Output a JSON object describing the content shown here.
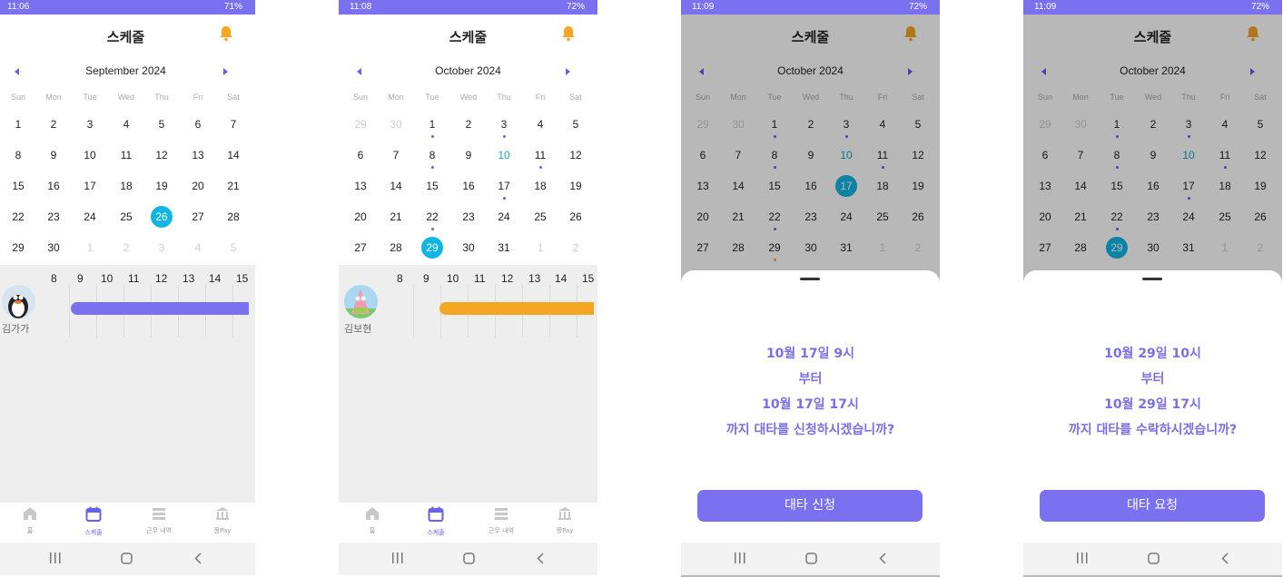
{
  "colors": {
    "accent": "#7b70f0",
    "selected": "#11b5e4",
    "today": "#1da1c8",
    "bell": "#f5a623",
    "bar_purple": "#7b70f0",
    "bar_orange": "#f5a623"
  },
  "weekdays": [
    "Sun",
    "Mon",
    "Tue",
    "Wed",
    "Thu",
    "Fri",
    "Sat"
  ],
  "screens": [
    {
      "status": {
        "time": "11:06",
        "right": "71%"
      },
      "header": {
        "title": "스케줄"
      },
      "month": "September 2024",
      "days": [
        [
          "1",
          "2",
          "3",
          "4",
          "5",
          "6",
          "7"
        ],
        [
          "8",
          "9",
          "10",
          "11",
          "12",
          "13",
          "14"
        ],
        [
          "15",
          "16",
          "17",
          "18",
          "19",
          "20",
          "21"
        ],
        [
          "22",
          "23",
          "24",
          "25",
          "26",
          "27",
          "28"
        ],
        [
          "29",
          "30",
          "1",
          "2",
          "3",
          "4",
          "5"
        ]
      ],
      "hours": [
        "8",
        "9",
        "10",
        "11",
        "12",
        "13",
        "14",
        "15"
      ],
      "user": {
        "name": "김가가"
      },
      "nav": [
        "홈",
        "스케줄",
        "근무 내역",
        "짱Pay"
      ]
    },
    {
      "status": {
        "time": "11:08",
        "right": "72%"
      },
      "header": {
        "title": "스케줄"
      },
      "month": "October 2024",
      "days": [
        [
          "29",
          "30",
          "1",
          "2",
          "3",
          "4",
          "5"
        ],
        [
          "6",
          "7",
          "8",
          "9",
          "10",
          "11",
          "12"
        ],
        [
          "13",
          "14",
          "15",
          "16",
          "17",
          "18",
          "19"
        ],
        [
          "20",
          "21",
          "22",
          "23",
          "24",
          "25",
          "26"
        ],
        [
          "27",
          "28",
          "29",
          "30",
          "31",
          "1",
          "2"
        ]
      ],
      "hours": [
        "8",
        "9",
        "10",
        "11",
        "12",
        "13",
        "14",
        "15"
      ],
      "user": {
        "name": "김보현"
      },
      "nav": [
        "홈",
        "스케줄",
        "근무 내역",
        "짱Pay"
      ]
    },
    {
      "status": {
        "time": "11:09",
        "right": "72%"
      },
      "header": {
        "title": "스케줄"
      },
      "month": "October 2024",
      "days": [
        [
          "29",
          "30",
          "1",
          "2",
          "3",
          "4",
          "5"
        ],
        [
          "6",
          "7",
          "8",
          "9",
          "10",
          "11",
          "12"
        ],
        [
          "13",
          "14",
          "15",
          "16",
          "17",
          "18",
          "19"
        ],
        [
          "20",
          "21",
          "22",
          "23",
          "24",
          "25",
          "26"
        ],
        [
          "27",
          "28",
          "29",
          "30",
          "31",
          "1",
          "2"
        ]
      ],
      "sheet": {
        "lines": [
          "10월 17일 9시",
          "부터",
          "10월 17일 17시",
          "까지 대타를 신청하시겠습니까?"
        ],
        "button": "대타 신청"
      }
    },
    {
      "status": {
        "time": "11:09",
        "right": "72%"
      },
      "header": {
        "title": "스케줄"
      },
      "month": "October 2024",
      "days": [
        [
          "29",
          "30",
          "1",
          "2",
          "3",
          "4",
          "5"
        ],
        [
          "6",
          "7",
          "8",
          "9",
          "10",
          "11",
          "12"
        ],
        [
          "13",
          "14",
          "15",
          "16",
          "17",
          "18",
          "19"
        ],
        [
          "20",
          "21",
          "22",
          "23",
          "24",
          "25",
          "26"
        ],
        [
          "27",
          "28",
          "29",
          "30",
          "31",
          "1",
          "2"
        ]
      ],
      "sheet": {
        "lines": [
          "10월 29일 10시",
          "부터",
          "10월 29일 17시",
          "까지 대타를 수락하시겠습니까?"
        ],
        "button": "대타 요청"
      }
    }
  ]
}
